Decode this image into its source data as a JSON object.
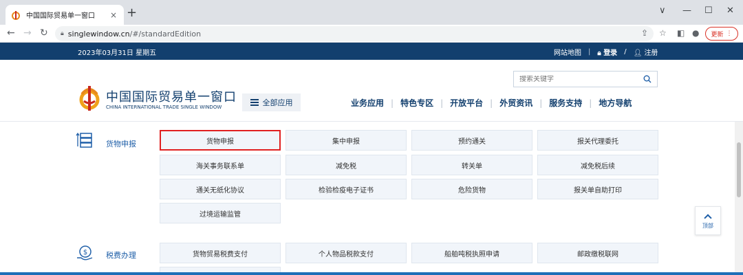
{
  "browser": {
    "tab_title": "中国国际贸易单一窗口",
    "tab_close": "×",
    "new_tab": "+",
    "url_host": "singlewindow.cn",
    "url_path": "/#/standardEdition",
    "update_label": "更新",
    "controls": {
      "chevron": "∨",
      "minimize": "—",
      "maximize": "☐",
      "close": "✕"
    }
  },
  "topstrip": {
    "date": "2023年03月31日 星期五",
    "sitemap": "网站地图",
    "sep": "|",
    "login": "登录",
    "slash": "/",
    "register": "注册"
  },
  "header": {
    "search_placeholder": "搜索关键字",
    "logo_cn": "中国国际贸易单一窗口",
    "logo_en": "CHINA INTERNATIONAL TRADE SINGLE WINDOW",
    "all_apps": "全部应用",
    "nav": [
      "业务应用",
      "特色专区",
      "开放平台",
      "外贸资讯",
      "服务支持",
      "地方导航"
    ]
  },
  "sections": [
    {
      "label": "货物申报",
      "icon": "server-stack-icon",
      "tiles": [
        "货物申报",
        "集中申报",
        "预约通关",
        "报关代理委托",
        "海关事务联系单",
        "减免税",
        "转关单",
        "减免税后续",
        "通关无纸化协议",
        "检验检疫电子证书",
        "危险货物",
        "报关单自助打印",
        "过境运输监管"
      ],
      "selected_index": 0
    },
    {
      "label": "税费办理",
      "icon": "dollar-coin-icon",
      "tiles": [
        "货物贸易税费支付",
        "个人物品税款支付",
        "船舶吨税执照申请",
        "邮政缴税联网"
      ]
    }
  ],
  "totop_label": "顶部",
  "colors": {
    "brand_navy": "#123f6e",
    "accent_blue": "#1f5fa8",
    "highlight_red": "#e02020"
  }
}
